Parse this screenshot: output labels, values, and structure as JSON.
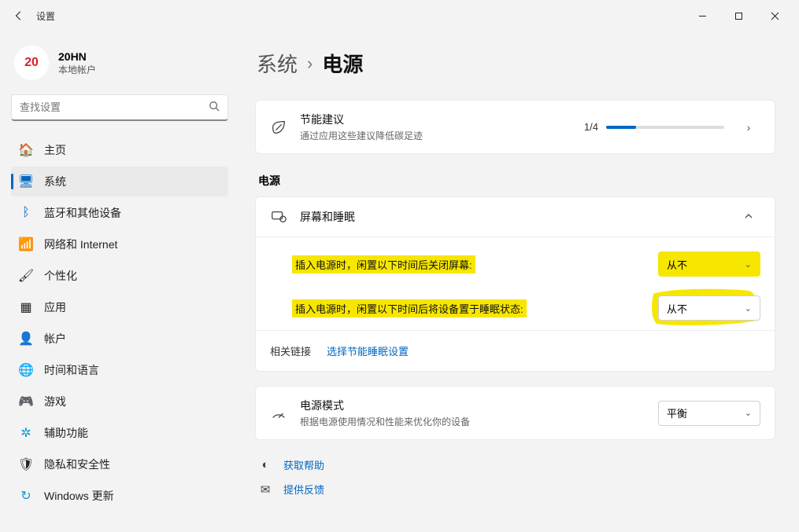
{
  "window": {
    "title": "设置"
  },
  "profile": {
    "name": "20HN",
    "subtitle": "本地帐户",
    "logo_text": "20"
  },
  "search": {
    "placeholder": "查找设置"
  },
  "nav": {
    "home": "主页",
    "system": "系统",
    "bluetooth": "蓝牙和其他设备",
    "network": "网络和 Internet",
    "personalize": "个性化",
    "apps": "应用",
    "accounts": "帐户",
    "time": "时间和语言",
    "gaming": "游戏",
    "accessibility": "辅助功能",
    "privacy": "隐私和安全性",
    "update": "Windows 更新"
  },
  "breadcrumb": {
    "root": "系统",
    "current": "电源"
  },
  "eco": {
    "title": "节能建议",
    "sub": "通过应用这些建议降低碳足迹",
    "progress": "1/4"
  },
  "section_power": "电源",
  "screen_sleep": {
    "title": "屏幕和睡眠",
    "opt1_label": "插入电源时，闲置以下时间后关闭屏幕:",
    "opt1_value": "从不",
    "opt2_label": "插入电源时，闲置以下时间后将设备置于睡眠状态:",
    "opt2_value": "从不",
    "related_label": "相关链接",
    "related_link": "选择节能睡眠设置"
  },
  "power_mode": {
    "title": "电源模式",
    "sub": "根据电源使用情况和性能来优化你的设备",
    "value": "平衡"
  },
  "help": {
    "get": "获取帮助",
    "feedback": "提供反馈"
  }
}
